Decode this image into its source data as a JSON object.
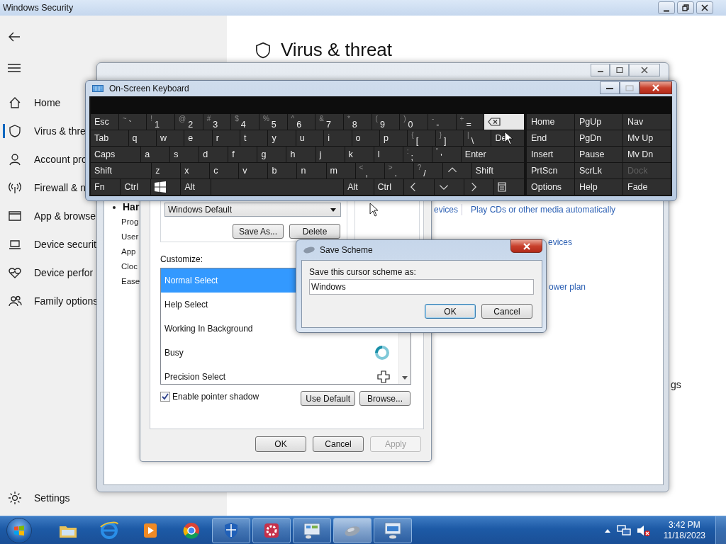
{
  "security_window": {
    "title": "Windows Security",
    "heading": "Virus & threat",
    "fragment": "gs",
    "sidebar": {
      "items": [
        {
          "label": "Home",
          "selected": false
        },
        {
          "label": "Virus & thre",
          "selected": true
        },
        {
          "label": "Account pro",
          "selected": false
        },
        {
          "label": "Firewall & n",
          "selected": false
        },
        {
          "label": "App & browse",
          "selected": false
        },
        {
          "label": "Device securit",
          "selected": false
        },
        {
          "label": "Device perfor",
          "selected": false
        },
        {
          "label": "Family options",
          "selected": false
        }
      ],
      "settings": "Settings"
    }
  },
  "control_panel": {
    "nav": {
      "heading": "Har",
      "items": [
        "Prog",
        "User",
        "App",
        "Cloc",
        "Ease"
      ]
    },
    "links": {
      "devices": "evices",
      "autoplay": "Play CDs or other media automatically",
      "devices_2": "evices",
      "power": "ower plan"
    }
  },
  "mouse_dialog": {
    "scheme": "Windows Default",
    "scheme_buttons": [
      "Save As...",
      "Delete"
    ],
    "customize_label": "Customize:",
    "cursors": [
      {
        "name": "Normal Select",
        "selected": true
      },
      {
        "name": "Help Select",
        "selected": false
      },
      {
        "name": "Working In Background",
        "selected": false
      },
      {
        "name": "Busy",
        "selected": false
      },
      {
        "name": "Precision Select",
        "selected": false
      }
    ],
    "shadow": {
      "label": "Enable pointer shadow",
      "checked": true
    },
    "cursor_buttons": [
      "Use Default",
      "Browse..."
    ],
    "buttons": [
      {
        "label": "OK",
        "disabled": false
      },
      {
        "label": "Cancel",
        "disabled": false
      },
      {
        "label": "Apply",
        "disabled": true
      }
    ]
  },
  "save_scheme": {
    "title": "Save Scheme",
    "prompt": "Save this cursor scheme as:",
    "value": "Windows ",
    "buttons": [
      {
        "label": "OK",
        "default": true
      },
      {
        "label": "Cancel",
        "default": false
      }
    ]
  },
  "osk": {
    "title": "On-Screen Keyboard",
    "rows": [
      [
        {
          "kind": "text",
          "label": "Esc",
          "hovered": false
        },
        {
          "kind": "text",
          "shift": "~",
          "label": "`",
          "hovered": false
        },
        {
          "kind": "text",
          "shift": "!",
          "label": "1",
          "hovered": false
        },
        {
          "kind": "text",
          "shift": "@",
          "label": "2",
          "hovered": false
        },
        {
          "kind": "text",
          "shift": "#",
          "label": "3",
          "hovered": false
        },
        {
          "kind": "text",
          "shift": "$",
          "label": "4",
          "hovered": false
        },
        {
          "kind": "text",
          "shift": "%",
          "label": "5",
          "hovered": false
        },
        {
          "kind": "text",
          "shift": "^",
          "label": "6",
          "hovered": false
        },
        {
          "kind": "text",
          "shift": "&",
          "label": "7",
          "hovered": false
        },
        {
          "kind": "text",
          "shift": "*",
          "label": "8",
          "hovered": false
        },
        {
          "kind": "text",
          "shift": "(",
          "label": "9",
          "hovered": false
        },
        {
          "kind": "text",
          "shift": ")",
          "label": "0",
          "hovered": false
        },
        {
          "kind": "text",
          "shift": "-",
          "label": "-",
          "hovered": false
        },
        {
          "kind": "text",
          "shift": "+",
          "label": "=",
          "hovered": false
        },
        {
          "kind": "backspace",
          "hovered": true
        }
      ],
      [
        {
          "kind": "text",
          "label": "Tab",
          "hovered": false
        },
        {
          "kind": "text",
          "label": "q",
          "hovered": false
        },
        {
          "kind": "text",
          "label": "w",
          "hovered": false
        },
        {
          "kind": "text",
          "label": "e",
          "hovered": false
        },
        {
          "kind": "text",
          "label": "r",
          "hovered": false
        },
        {
          "kind": "text",
          "label": "t",
          "hovered": false
        },
        {
          "kind": "text",
          "label": "y",
          "hovered": false
        },
        {
          "kind": "text",
          "label": "u",
          "hovered": false
        },
        {
          "kind": "text",
          "label": "i",
          "hovered": false
        },
        {
          "kind": "text",
          "label": "o",
          "hovered": false
        },
        {
          "kind": "text",
          "label": "p",
          "hovered": false
        },
        {
          "kind": "text",
          "shift": "{",
          "label": "[",
          "hovered": false
        },
        {
          "kind": "text",
          "shift": "}",
          "label": "]",
          "hovered": false
        },
        {
          "kind": "text",
          "shift": "|",
          "label": "\\",
          "hovered": false
        },
        {
          "kind": "text",
          "label": "De",
          "hovered": false
        }
      ],
      [
        {
          "kind": "text",
          "label": "Caps",
          "hovered": false
        },
        {
          "kind": "text",
          "label": "a",
          "hovered": false
        },
        {
          "kind": "text",
          "label": "s",
          "hovered": false
        },
        {
          "kind": "text",
          "label": "d",
          "hovered": false
        },
        {
          "kind": "text",
          "label": "f",
          "hovered": false
        },
        {
          "kind": "text",
          "label": "g",
          "hovered": false
        },
        {
          "kind": "text",
          "label": "h",
          "hovered": false
        },
        {
          "kind": "text",
          "label": "j",
          "hovered": false
        },
        {
          "kind": "text",
          "label": "k",
          "hovered": false
        },
        {
          "kind": "text",
          "label": "l",
          "hovered": false
        },
        {
          "kind": "text",
          "shift": ":",
          "label": ";",
          "hovered": false
        },
        {
          "kind": "text",
          "shift": "\"",
          "label": "'",
          "hovered": false
        },
        {
          "kind": "text",
          "label": "Enter",
          "hovered": false
        }
      ],
      [
        {
          "kind": "text",
          "label": "Shift",
          "hovered": false
        },
        {
          "kind": "text",
          "label": "z",
          "hovered": false
        },
        {
          "kind": "text",
          "label": "x",
          "hovered": false
        },
        {
          "kind": "text",
          "label": "c",
          "hovered": false
        },
        {
          "kind": "text",
          "label": "v",
          "hovered": false
        },
        {
          "kind": "text",
          "label": "b",
          "hovered": false
        },
        {
          "kind": "text",
          "label": "n",
          "hovered": false
        },
        {
          "kind": "text",
          "label": "m",
          "hovered": false
        },
        {
          "kind": "text",
          "shift": "<",
          "label": ",",
          "hovered": false
        },
        {
          "kind": "text",
          "shift": ">",
          "label": ".",
          "hovered": false
        },
        {
          "kind": "text",
          "shift": "?",
          "label": "/",
          "hovered": false
        },
        {
          "kind": "up",
          "hovered": false
        },
        {
          "kind": "text",
          "label": "Shift",
          "hovered": false
        }
      ],
      [
        {
          "kind": "text",
          "label": "Fn",
          "hovered": false
        },
        {
          "kind": "text",
          "label": "Ctrl",
          "hovered": false
        },
        {
          "kind": "windows",
          "hovered": false
        },
        {
          "kind": "text",
          "label": "Alt",
          "hovered": false
        },
        {
          "kind": "space",
          "hovered": false
        },
        {
          "kind": "text",
          "label": "Alt",
          "hovered": false
        },
        {
          "kind": "text",
          "label": "Ctrl",
          "hovered": false
        },
        {
          "kind": "left",
          "hovered": false
        },
        {
          "kind": "down",
          "hovered": false
        },
        {
          "kind": "right",
          "hovered": false
        },
        {
          "kind": "menu",
          "hovered": false
        }
      ]
    ],
    "nav_keys": [
      {
        "label": "Home",
        "disabled": false
      },
      {
        "label": "PgUp",
        "disabled": false
      },
      {
        "label": "Nav",
        "disabled": false
      },
      {
        "label": "End",
        "disabled": false
      },
      {
        "label": "PgDn",
        "disabled": false
      },
      {
        "label": "Mv Up",
        "disabled": false
      },
      {
        "label": "Insert",
        "disabled": false
      },
      {
        "label": "Pause",
        "disabled": false
      },
      {
        "label": "Mv Dn",
        "disabled": false
      },
      {
        "label": "PrtScn",
        "disabled": false
      },
      {
        "label": "ScrLk",
        "disabled": false
      },
      {
        "label": "Dock",
        "disabled": true
      },
      {
        "label": "Options",
        "disabled": false
      },
      {
        "label": "Help",
        "disabled": false
      },
      {
        "label": "Fade",
        "disabled": false
      }
    ]
  },
  "taskbar": {
    "items": [
      {
        "open": false,
        "selected": false
      },
      {
        "open": false,
        "selected": false
      },
      {
        "open": false,
        "selected": false
      },
      {
        "open": false,
        "selected": false
      },
      {
        "open": true,
        "selected": false
      },
      {
        "open": true,
        "selected": false
      },
      {
        "open": true,
        "selected": false
      },
      {
        "open": true,
        "selected": true
      },
      {
        "open": true,
        "selected": false
      }
    ],
    "time": "3:42 PM",
    "date": "11/18/2023"
  }
}
